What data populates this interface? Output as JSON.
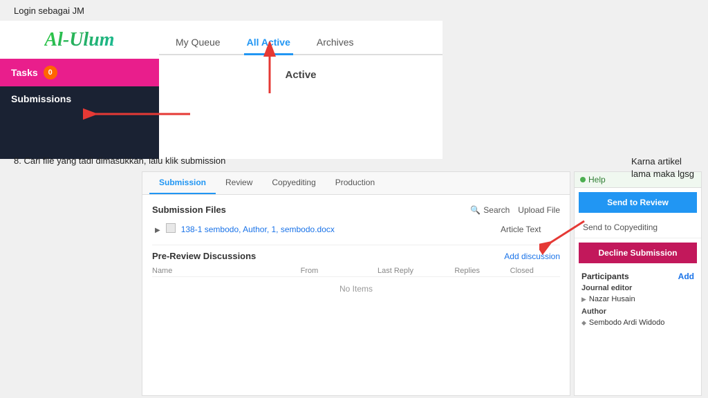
{
  "annotations": {
    "top": "Login sebagai JM",
    "bottom_left": "8. Cari file yang tadi dimasukkan, lalu klik submission",
    "bottom_right_line1": "Karna artikel",
    "bottom_right_line2": "lama maka lgsg"
  },
  "logo": {
    "text": "Al-Ulum"
  },
  "sidebar": {
    "tasks_label": "Tasks",
    "tasks_count": "0",
    "submissions_label": "Submissions"
  },
  "tabs": {
    "my_queue": "My Queue",
    "all_active": "All Active",
    "archives": "Archives",
    "active_label": "Active"
  },
  "panel": {
    "tabs": [
      "Submission",
      "Review",
      "Copyediting",
      "Production"
    ],
    "active_tab": "Submission",
    "submission_files": {
      "title": "Submission Files",
      "search_label": "Search",
      "upload_label": "Upload File",
      "file": {
        "id": "138-1",
        "name": "sembodo, Author, 1, sembodo.docx",
        "type": "Article Text"
      }
    },
    "pre_review": {
      "title": "Pre-Review Discussions",
      "add_label": "Add discussion",
      "columns": [
        "Name",
        "From",
        "Last Reply",
        "Replies",
        "Closed"
      ],
      "no_items": "No Items"
    }
  },
  "right_panel": {
    "help_label": "Help",
    "send_review_label": "Send to Review",
    "send_copyediting_label": "Send to Copyediting",
    "decline_label": "Decline Submission",
    "participants": {
      "title": "Participants",
      "add_label": "Add",
      "roles": [
        {
          "role": "Journal editor",
          "members": [
            "Nazar Husain"
          ]
        },
        {
          "role": "Author",
          "members": [
            "Sembodo Ardi Widodo"
          ]
        }
      ]
    }
  }
}
